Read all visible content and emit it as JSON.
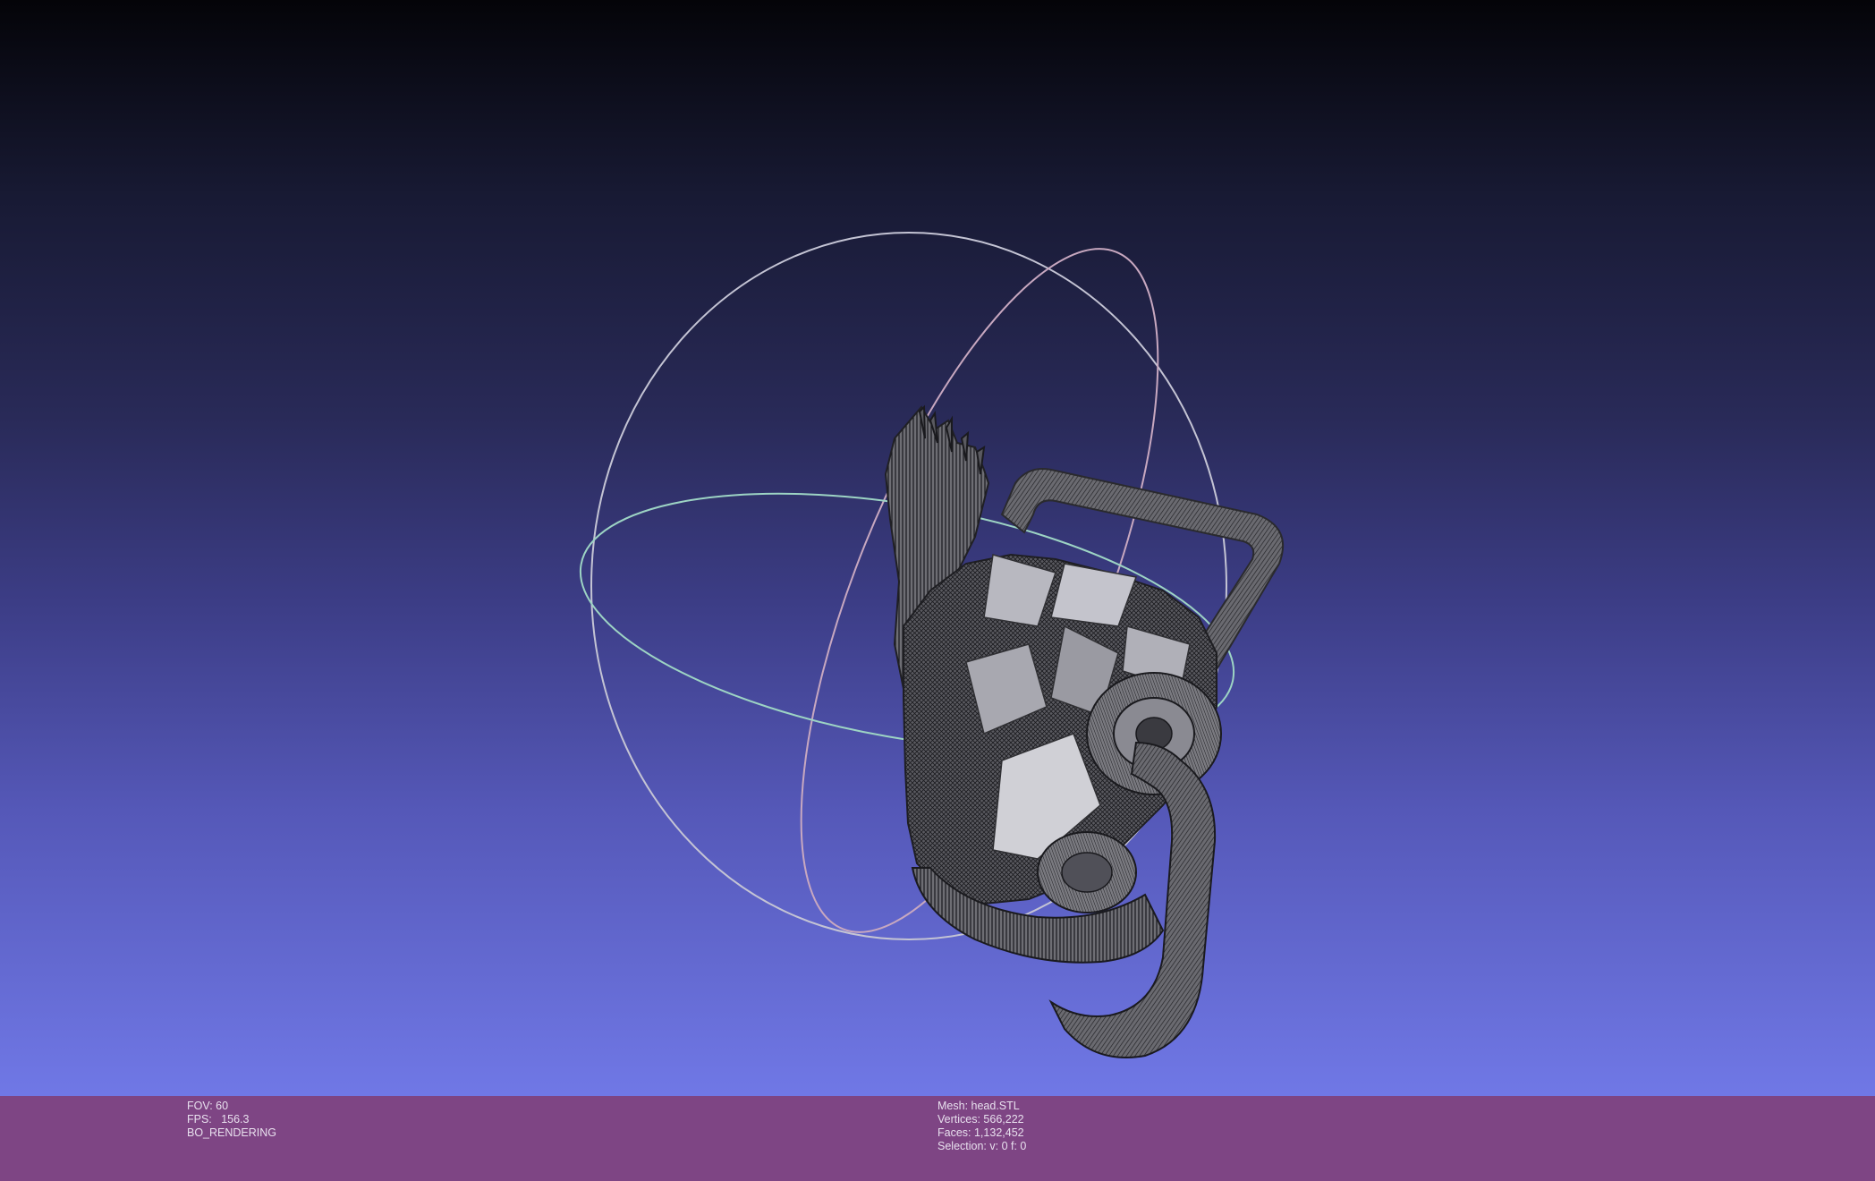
{
  "viewport": {
    "background_top": "#040408",
    "background_bottom": "#7078e6",
    "trackball": {
      "ring_colors": {
        "x_axis_ring": "#9fd8c8",
        "y_axis_ring": "#f0b8c8",
        "z_axis_ring": "#c8c8d8"
      }
    },
    "mesh_render_mode": "wireframe-shaded"
  },
  "status_bar": {
    "background": "#7e4584",
    "left": {
      "fov": "FOV: 60",
      "fps": "FPS:   156.3",
      "render_mode": "BO_RENDERING"
    },
    "right": {
      "mesh": "Mesh: head.STL",
      "vertices": "Vertices: 566,222",
      "faces": "Faces: 1,132,452",
      "selection": "Selection: v: 0 f: 0"
    }
  }
}
